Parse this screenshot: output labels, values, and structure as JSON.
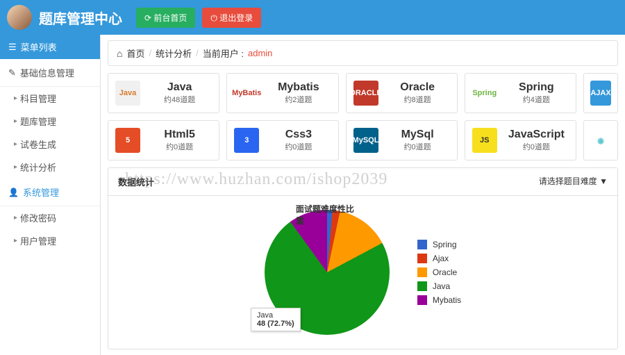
{
  "header": {
    "title": "题库管理中心",
    "btn_home": "前台首页",
    "btn_logout": "退出登录"
  },
  "sidebar": {
    "menu_list": "菜单列表",
    "section_basic": "基础信息管理",
    "items_basic": [
      "科目管理",
      "题库管理",
      "试卷生成",
      "统计分析"
    ],
    "section_system": "系统管理",
    "items_system": [
      "修改密码",
      "用户管理"
    ]
  },
  "breadcrumb": {
    "home": "首页",
    "page": "统计分析",
    "user_label": "当前用户 :",
    "user": "admin"
  },
  "cards": [
    {
      "title": "Java",
      "sub": "约48道题",
      "icon_text": "Java",
      "icon_bg": "#f0f0f0",
      "icon_color": "#d97b2e"
    },
    {
      "title": "Mybatis",
      "sub": "约2道题",
      "icon_text": "MyBatis",
      "icon_bg": "#fff",
      "icon_color": "#c0392b"
    },
    {
      "title": "Oracle",
      "sub": "约8道题",
      "icon_text": "ORACLE",
      "icon_bg": "#c0392b",
      "icon_color": "#fff"
    },
    {
      "title": "Spring",
      "sub": "约4道题",
      "icon_text": "Spring",
      "icon_bg": "#fff",
      "icon_color": "#6db33f"
    },
    {
      "title": "AJAX",
      "sub": "",
      "icon_text": "AJAX",
      "icon_bg": "#3498db",
      "icon_color": "#fff",
      "narrow": true
    },
    {
      "title": "Html5",
      "sub": "约0道题",
      "icon_text": "5",
      "icon_bg": "#e44d26",
      "icon_color": "#fff"
    },
    {
      "title": "Css3",
      "sub": "约0道题",
      "icon_text": "3",
      "icon_bg": "#2965f1",
      "icon_color": "#fff"
    },
    {
      "title": "MySql",
      "sub": "约0道题",
      "icon_text": "MySQL",
      "icon_bg": "#00618a",
      "icon_color": "#fff"
    },
    {
      "title": "JavaScript",
      "sub": "约0道题",
      "icon_text": "JS",
      "icon_bg": "#f7df1e",
      "icon_color": "#323330"
    },
    {
      "title": "",
      "sub": "",
      "icon_text": "◉",
      "icon_bg": "#fff",
      "icon_color": "#5dc8cd",
      "narrow": true
    }
  ],
  "panel": {
    "title": "数据统计",
    "filter": "请选择题目难度 ▼"
  },
  "chart_data": {
    "type": "pie",
    "title": "面试题难度性比重",
    "series": [
      {
        "name": "Spring",
        "value": 1,
        "color": "#3366cc"
      },
      {
        "name": "Ajax",
        "value": 1,
        "color": "#dc3912"
      },
      {
        "name": "Oracle",
        "value": 9,
        "color": "#ff9900"
      },
      {
        "name": "Java",
        "value": 48,
        "color": "#109618"
      },
      {
        "name": "Mybatis",
        "value": 7,
        "color": "#990099"
      }
    ],
    "tooltip": {
      "label": "Java",
      "value": "48 (72.7%)"
    }
  },
  "watermark": "https://www.huzhan.com/ishop2039"
}
